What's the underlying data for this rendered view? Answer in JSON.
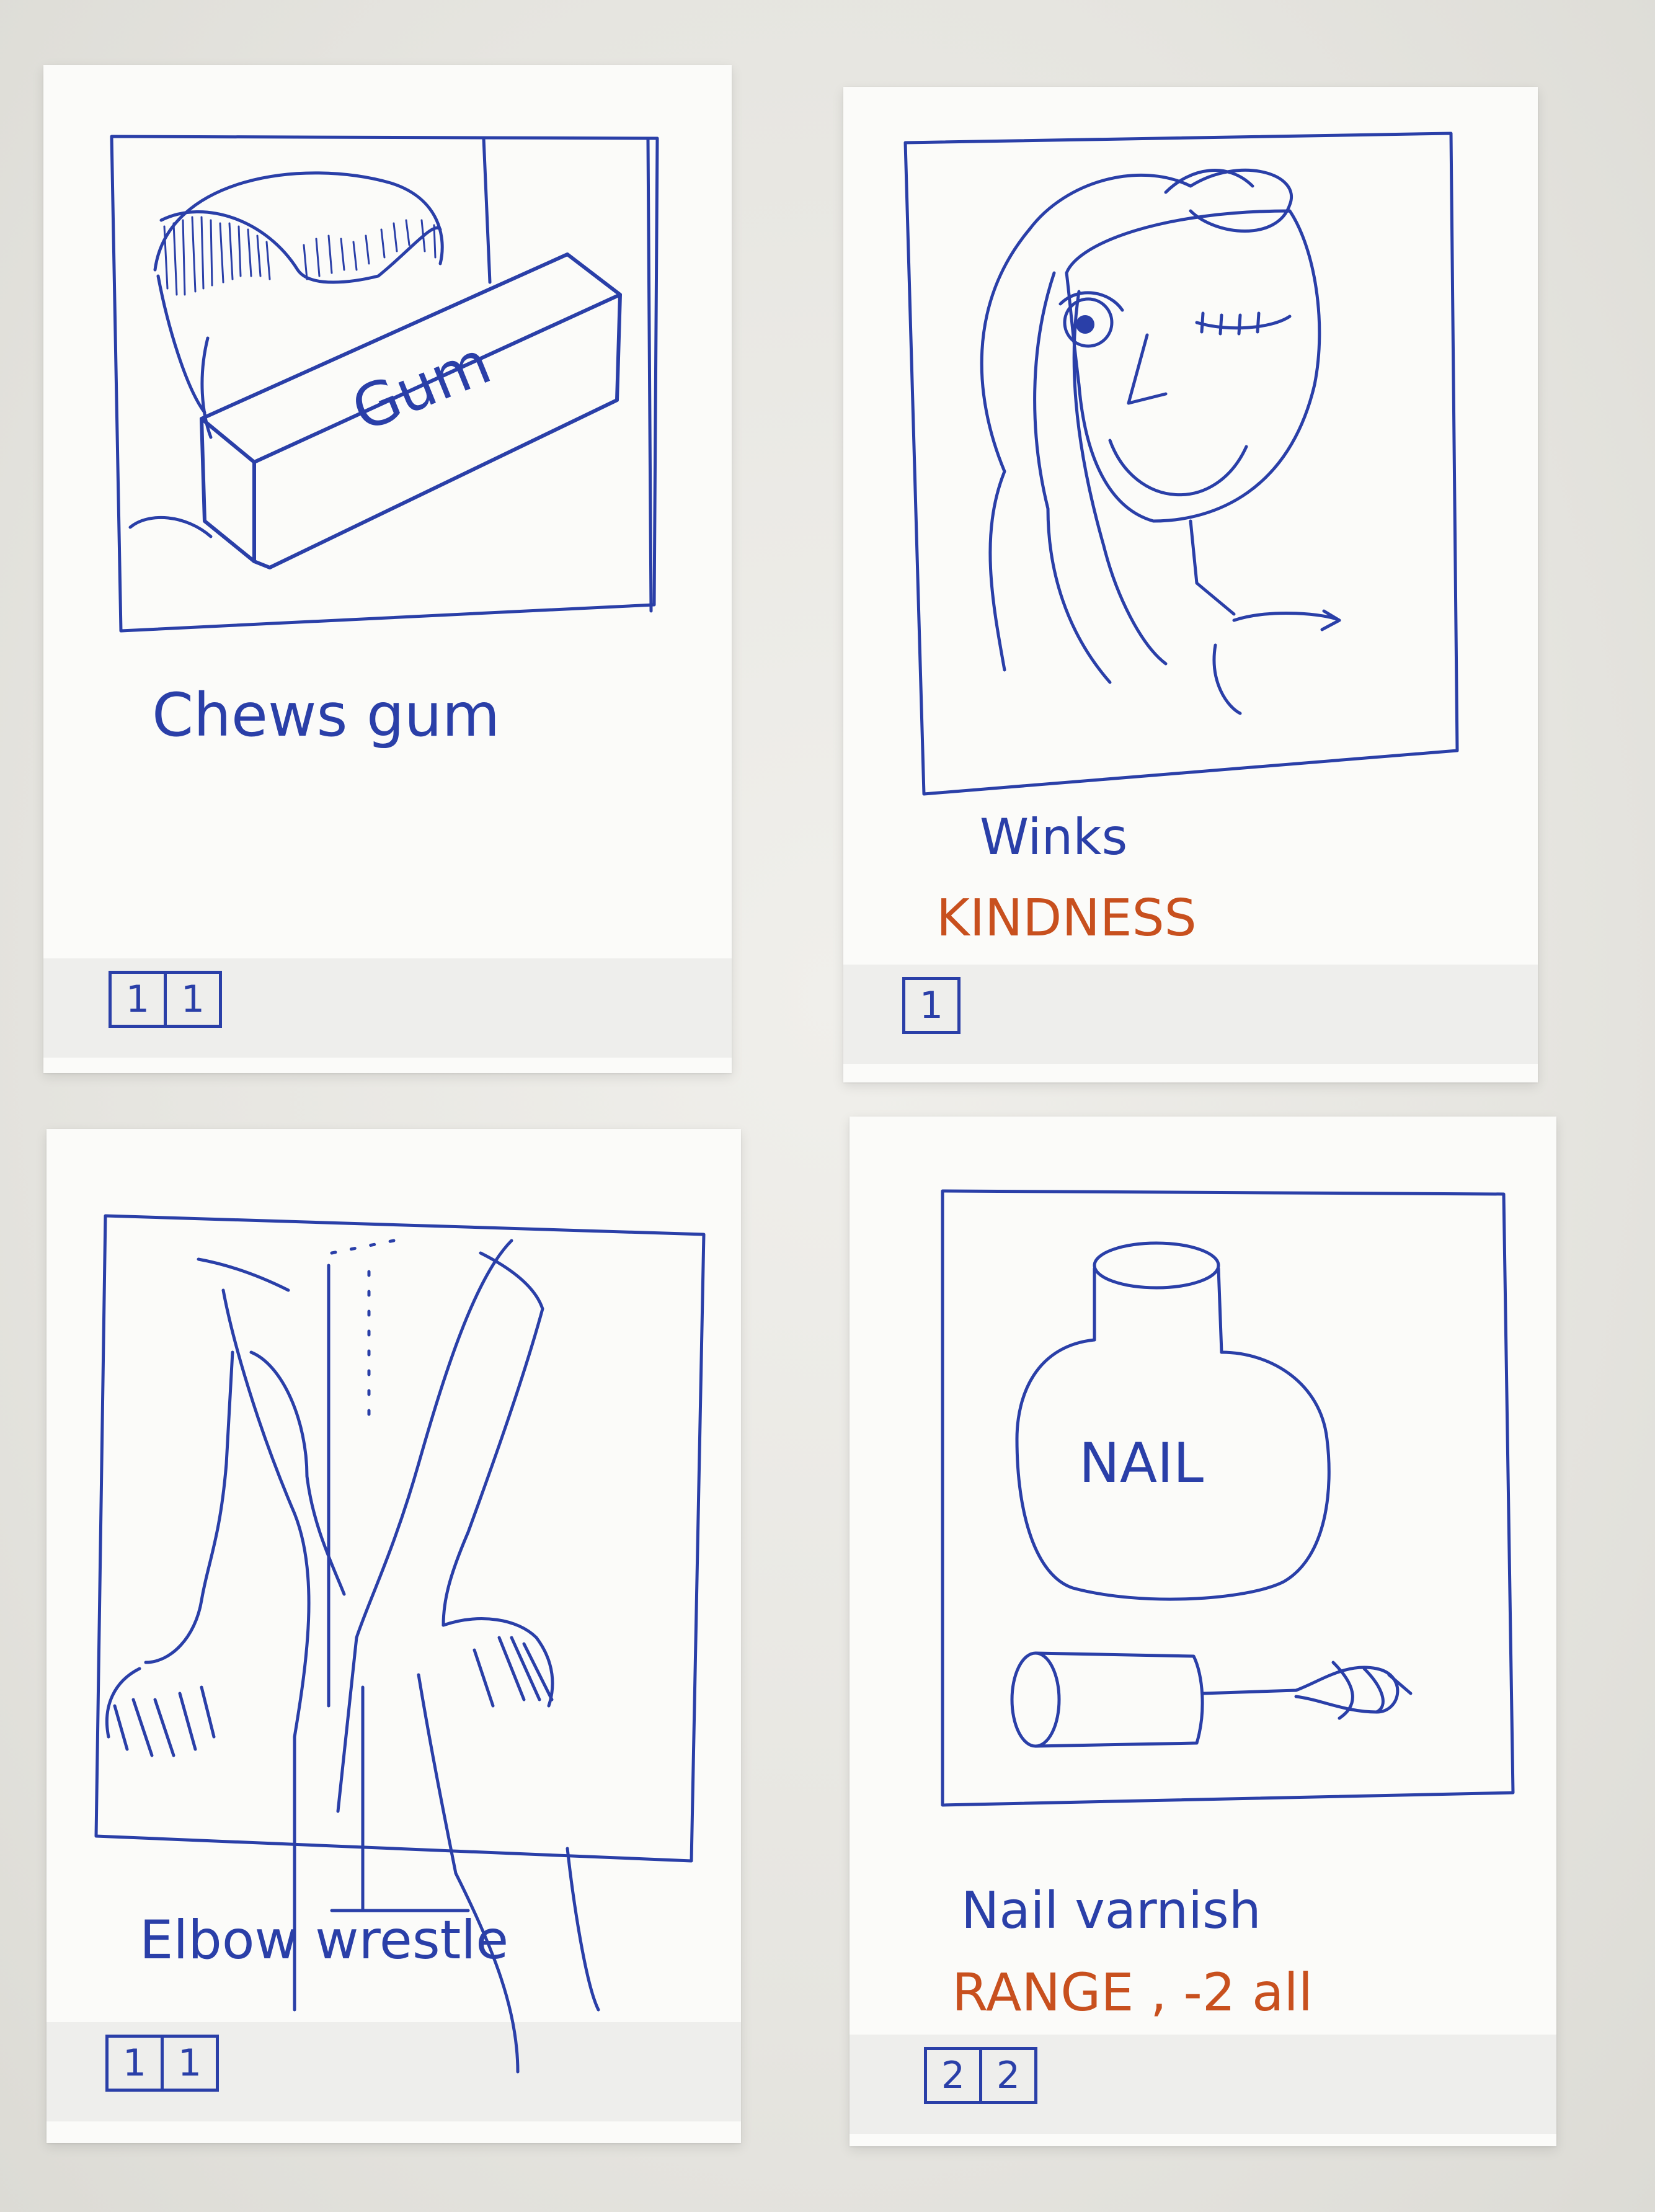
{
  "cards": [
    {
      "id": "chews-gum",
      "caption": "Chews gum",
      "drawing_text": "Gum",
      "boxes": [
        "1",
        "1"
      ]
    },
    {
      "id": "winks",
      "caption": "Winks",
      "effect": "KINDNESS",
      "boxes": [
        "1"
      ]
    },
    {
      "id": "elbow-wrestle",
      "caption": "Elbow wrestle",
      "boxes": [
        "1",
        "1"
      ]
    },
    {
      "id": "nail-varnish",
      "caption": "Nail varnish",
      "drawing_text": "NAIL",
      "effect": "RANGE , -2 all",
      "boxes": [
        "2",
        "2"
      ]
    }
  ],
  "colors": {
    "ink_blue": "#2a3fa8",
    "ink_orange": "#c8501e",
    "paper": "#fbfbf9",
    "background": "#e8e7e2"
  }
}
